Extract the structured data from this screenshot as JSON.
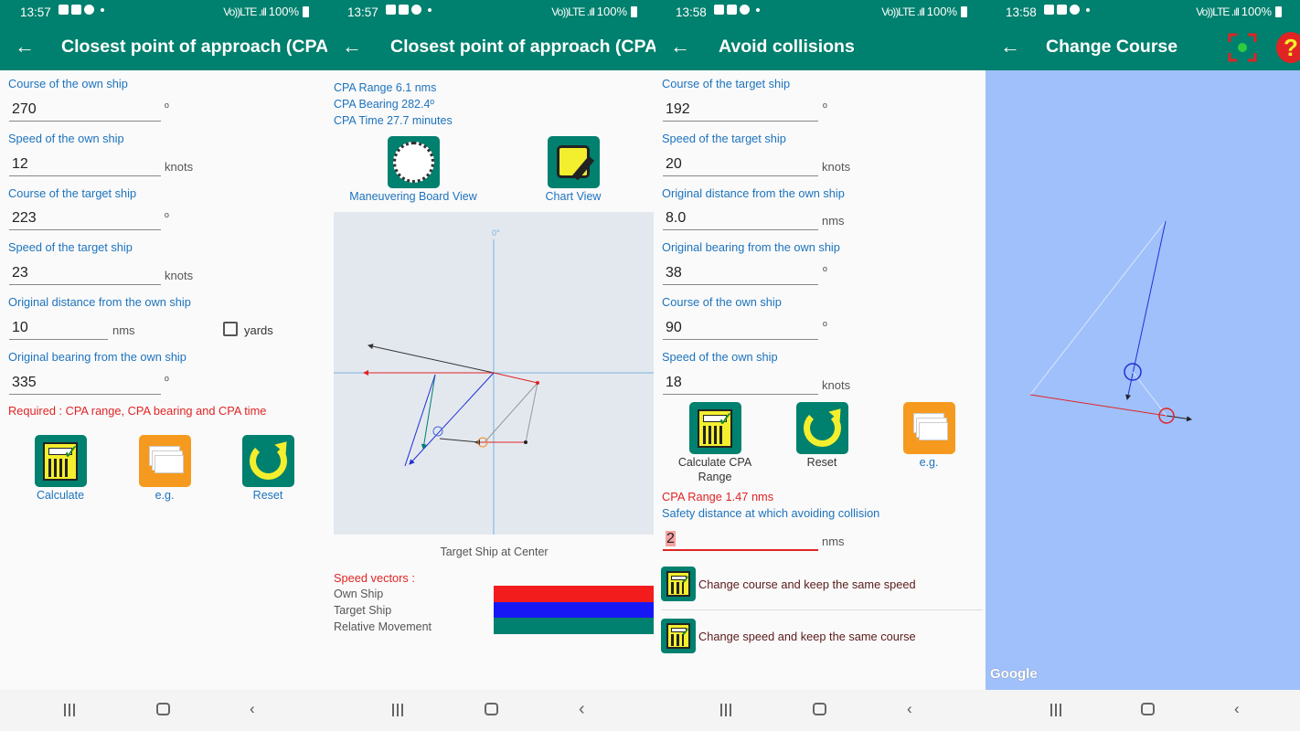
{
  "status": {
    "s1_time": "13:57",
    "s2_time": "13:57",
    "s3_time": "13:58",
    "s4_time": "13:58",
    "battery": "100%",
    "signal": "Vo))LTE .ıll"
  },
  "screen1": {
    "title": "Closest point of approach (CPA)",
    "own_course_label": "Course of the own ship",
    "own_course_value": "270",
    "own_course_unit": "º",
    "own_speed_label": "Speed of the own ship",
    "own_speed_value": "12",
    "own_speed_unit": "knots",
    "target_course_label": "Course of the target ship",
    "target_course_value": "223",
    "target_course_unit": "º",
    "target_speed_label": "Speed of the target ship",
    "target_speed_value": "23",
    "target_speed_unit": "knots",
    "distance_label": "Original distance from the own ship",
    "distance_value": "10",
    "distance_unit": "nms",
    "yards_label": "yards",
    "bearing_label": "Original bearing from the own ship",
    "bearing_value": "335",
    "bearing_unit": "º",
    "required_text": "Required : CPA range, CPA bearing and CPA time",
    "calculate_label": "Calculate",
    "eg_label": "e.g.",
    "reset_label": "Reset"
  },
  "screen2": {
    "title": "Closest point of approach (CPA)",
    "cpa_range": "CPA Range 6.1 nms",
    "cpa_bearing": "CPA Bearing 282.4º",
    "cpa_time": "CPA Time 27.7 minutes",
    "maneuvering_label": "Maneuvering Board View",
    "chart_label": "Chart View",
    "north_label": "0°",
    "center_caption": "Target Ship at Center",
    "speed_vectors_title": "Speed vectors :",
    "legend": [
      "Own Ship",
      "Target Ship",
      "Relative Movement"
    ],
    "legend_colors": [
      "#f21c1c",
      "#1717f5",
      "#00806e"
    ]
  },
  "screen3": {
    "title": "Avoid collisions",
    "target_course_label": "Course of the target ship",
    "target_course_value": "192",
    "target_course_unit": "º",
    "target_speed_label": "Speed of the target ship",
    "target_speed_value": "20",
    "target_speed_unit": "knots",
    "distance_label": "Original distance from the own ship",
    "distance_value": "8.0",
    "distance_unit": "nms",
    "bearing_label": "Original bearing from the own ship",
    "bearing_value": "38",
    "bearing_unit": "º",
    "own_course_label": "Course of the own ship",
    "own_course_value": "90",
    "own_course_unit": "º",
    "own_speed_label": "Speed of the own ship",
    "own_speed_value": "18",
    "own_speed_unit": "knots",
    "calc_cpa_label_line1": "Calculate CPA",
    "calc_cpa_label_line2": "Range",
    "reset_label": "Reset",
    "eg_label": "e.g.",
    "cpa_range_result": "CPA Range 1.47 nms",
    "safety_label": "Safety distance at which avoiding collision",
    "safety_value": "2",
    "safety_unit": "nms",
    "change_course_label": "Change course and keep the same speed",
    "change_speed_label": "Change speed and keep the same course"
  },
  "screen4": {
    "title": "Change Course",
    "map_attribution": "Google"
  }
}
